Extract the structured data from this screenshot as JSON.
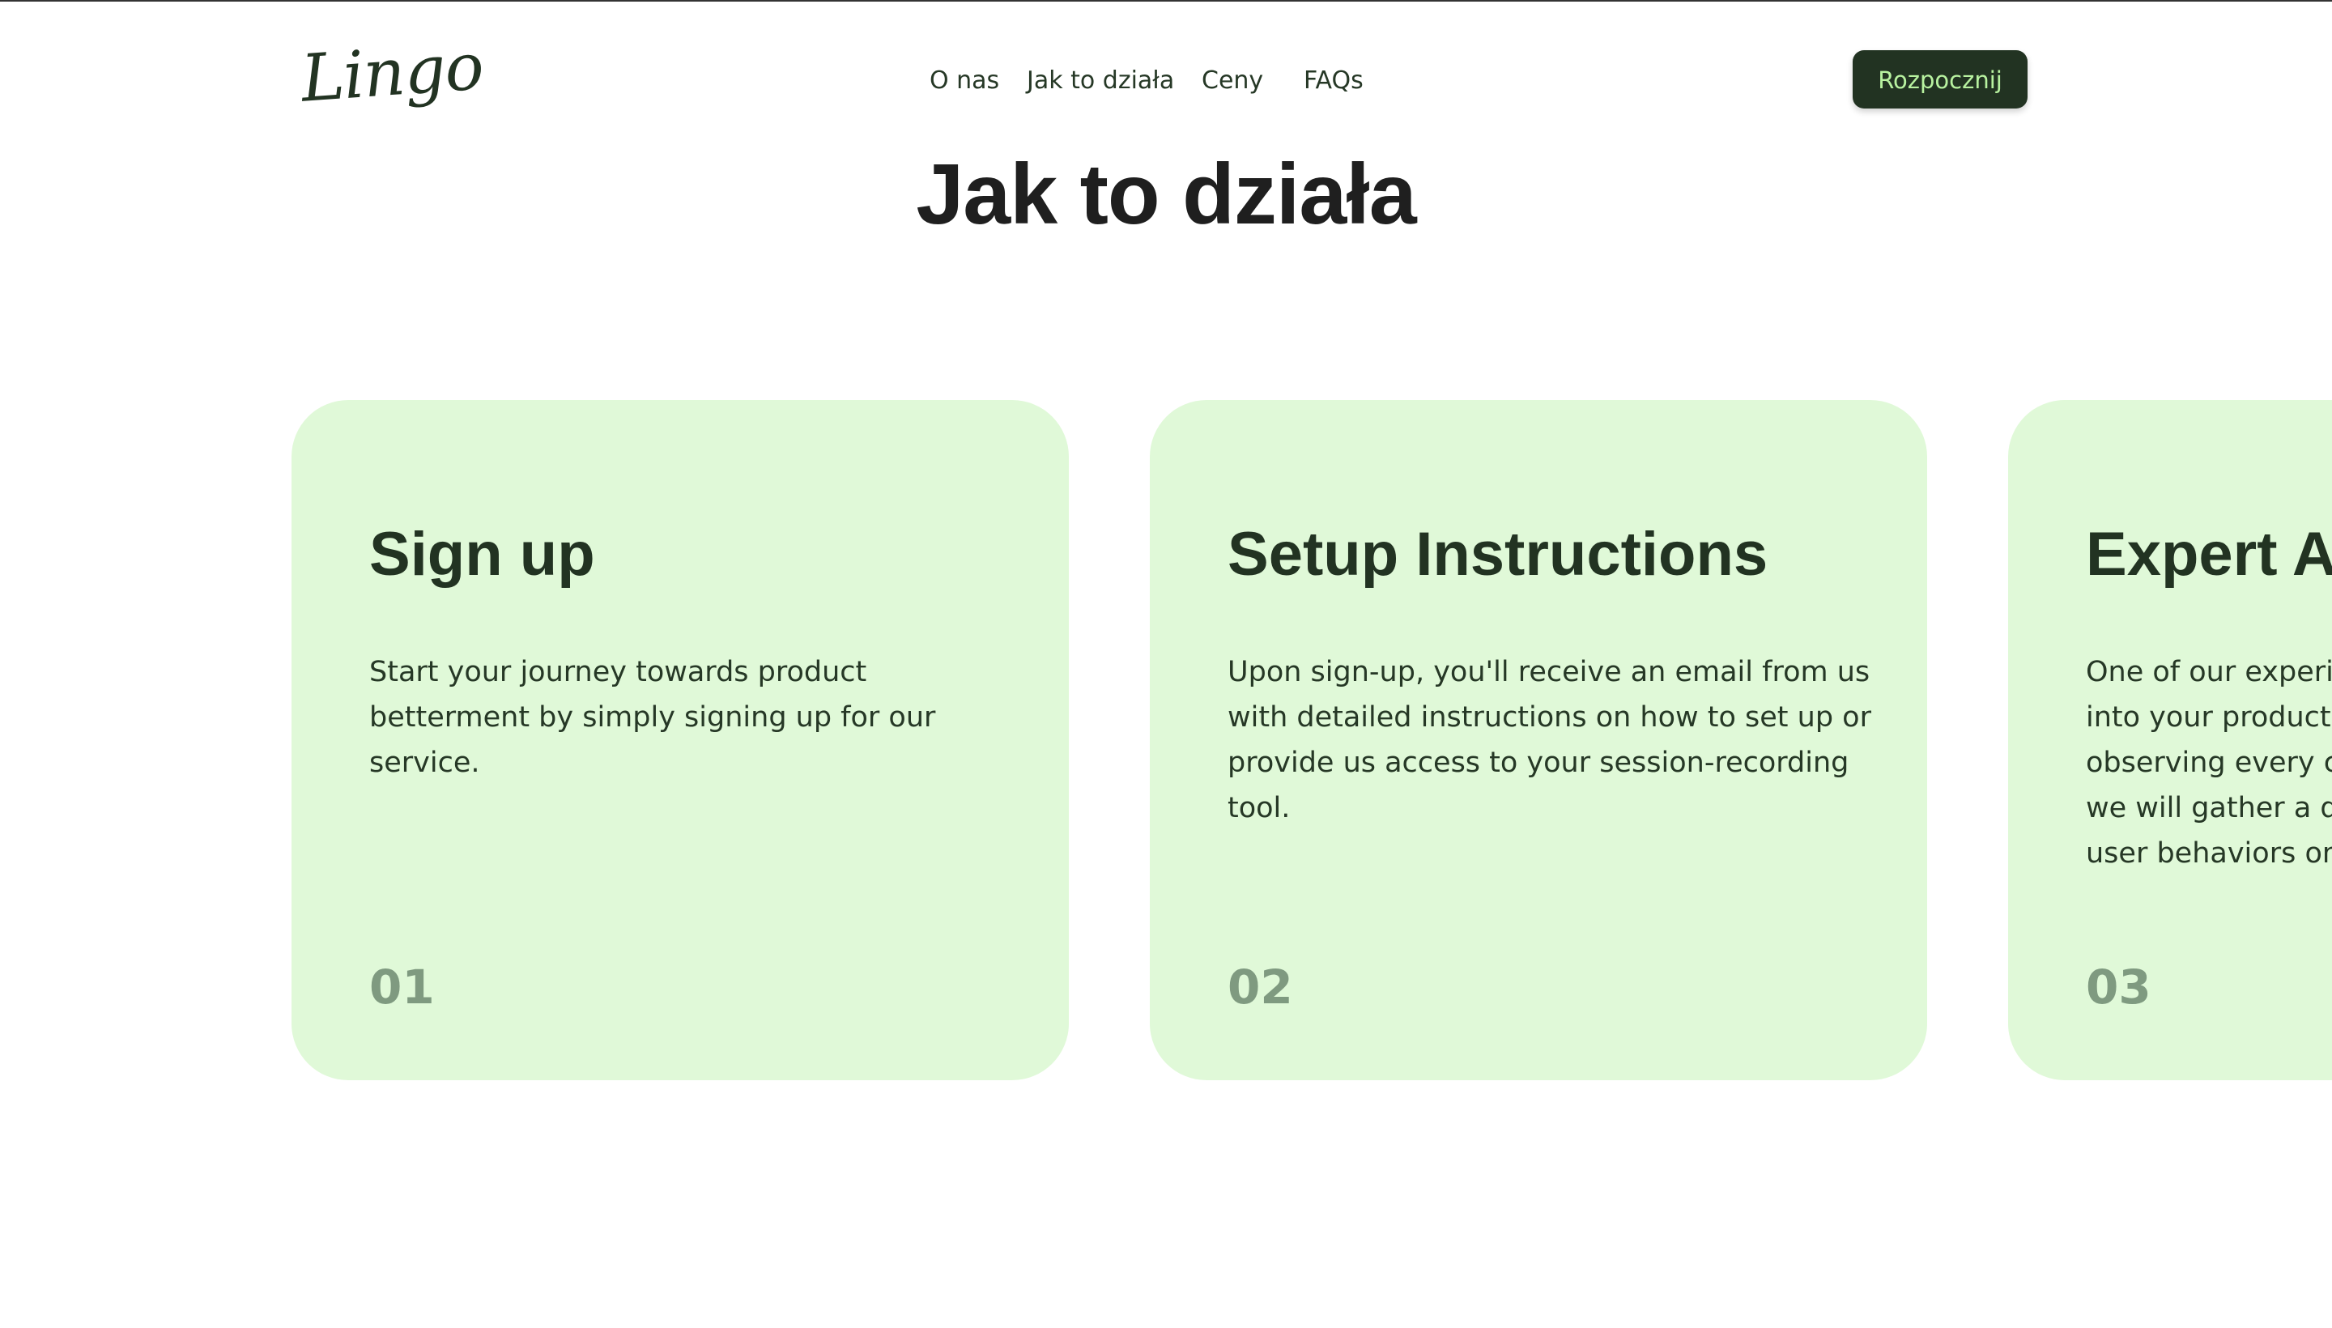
{
  "header": {
    "logo": "Lingo",
    "nav": [
      {
        "label": "O nas"
      },
      {
        "label": "Jak to działa"
      },
      {
        "label": "Ceny"
      },
      {
        "label": "FAQs"
      }
    ],
    "cta_label": "Rozpocznij"
  },
  "section": {
    "title": "Jak to działa"
  },
  "cards": [
    {
      "title": "Sign up",
      "lines": [
        "Start your journey towards product",
        "betterment by simply signing up for our",
        "service."
      ],
      "number": "01"
    },
    {
      "title": "Setup Instructions",
      "lines": [
        "Upon sign-up, you'll receive an email from us",
        "with detailed instructions on how to set up or",
        "provide us access to your session-recording",
        "tool."
      ],
      "number": "02"
    },
    {
      "title": "Expert Ar",
      "lines": [
        "One of our experie",
        "into your product",
        "observing every c",
        "we will gather a de",
        "user behaviors on"
      ],
      "number": "03"
    }
  ],
  "colors": {
    "card_bg": "#e0f9d8",
    "dark_green": "#223322",
    "cta_text": "#b8f2a0",
    "number_text": "#7f9a80"
  }
}
